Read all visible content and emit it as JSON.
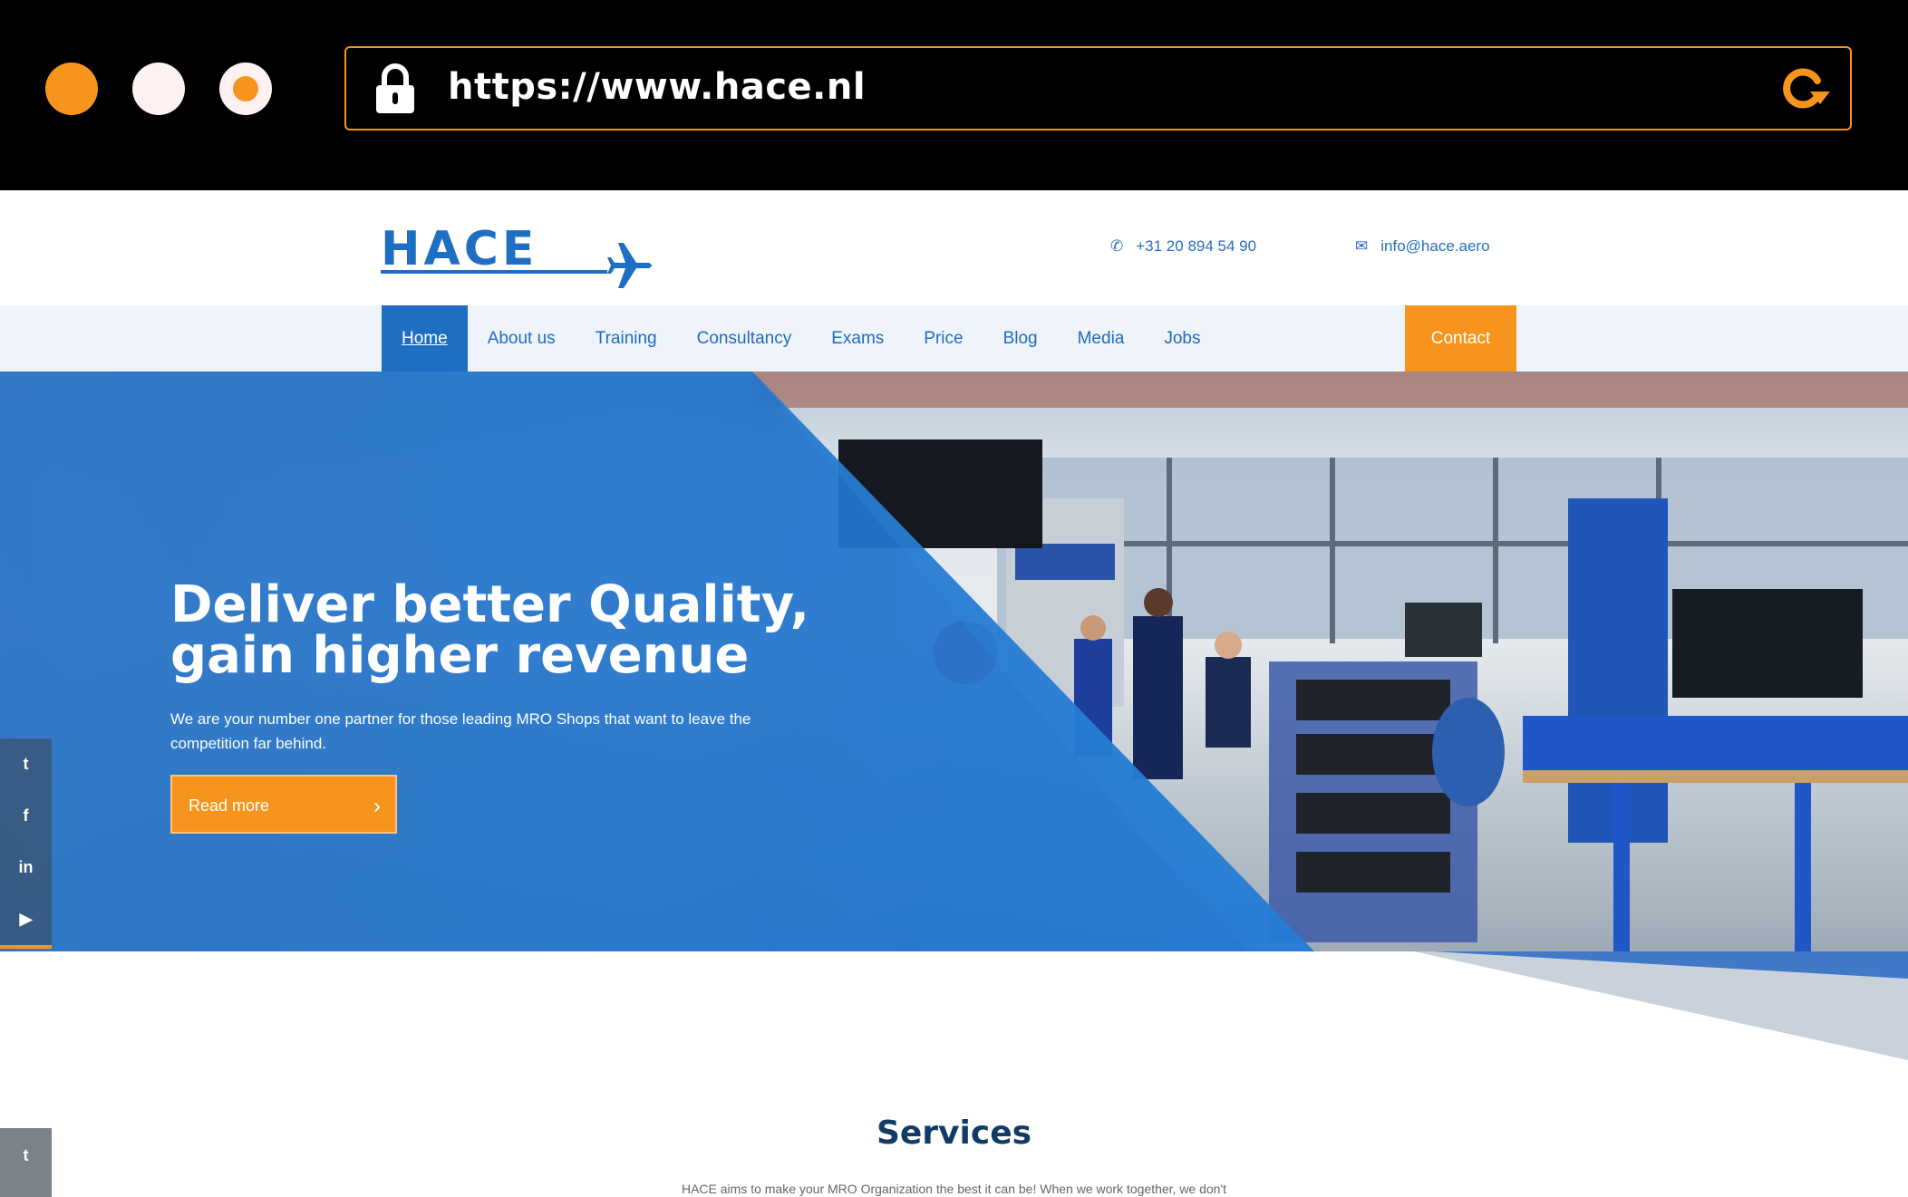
{
  "browser": {
    "url": "https://www.hace.nl"
  },
  "header": {
    "logo_text": "HACE",
    "phone": "+31 20 894 54 90",
    "email": "info@hace.aero"
  },
  "nav": {
    "items": [
      {
        "label": "Home"
      },
      {
        "label": "About us"
      },
      {
        "label": "Training"
      },
      {
        "label": "Consultancy"
      },
      {
        "label": "Exams"
      },
      {
        "label": "Price"
      },
      {
        "label": "Blog"
      },
      {
        "label": "Media"
      },
      {
        "label": "Jobs"
      }
    ],
    "contact_label": "Contact"
  },
  "hero": {
    "title_line1": "Deliver better Quality,",
    "title_line2": "gain higher revenue",
    "subtitle": "We are your number one partner for those leading MRO Shops that want to leave the competition far behind.",
    "button_label": "Read more"
  },
  "social": {
    "items": [
      {
        "icon": "twitter-icon",
        "glyph": "t"
      },
      {
        "icon": "facebook-icon",
        "glyph": "f"
      },
      {
        "icon": "linkedin-icon",
        "glyph": "in"
      },
      {
        "icon": "youtube-icon",
        "glyph": "▶"
      }
    ],
    "bottom_glyph": "t"
  },
  "services": {
    "title": "Services",
    "intro": "HACE aims to make your MRO Organization the best it can be! When we work together, we don't"
  },
  "colors": {
    "accent_orange": "#f7941e",
    "brand_blue": "#1e6fc4",
    "dark_navy": "#123a66"
  }
}
